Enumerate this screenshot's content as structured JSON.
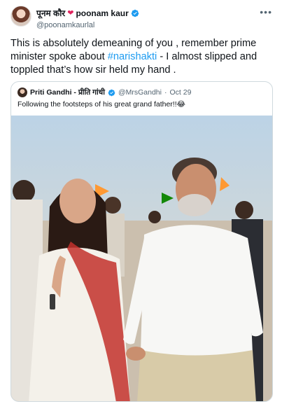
{
  "author": {
    "name_hindi": "पूनम कौर",
    "name": "poonam kaur",
    "handle": "@poonamkaurlal",
    "more_icon": "more-horizontal-icon"
  },
  "tweet": {
    "text_before": "This is absolutely demeaning of you , remember prime minister spoke about ",
    "hashtag": "#narishakti",
    "text_after": " - I almost slipped and toppled that’s how sir held my hand ."
  },
  "quoted": {
    "name": "Priti Gandhi - प्रीति गांधी",
    "handle": "@MrsGandhi",
    "separator": "·",
    "date": "Oct 29",
    "text": "Following the footsteps of his great grand father!!😂"
  },
  "colors": {
    "accent": "#1d9bf0",
    "heart": "#e0245e",
    "muted": "#536471",
    "border": "#cfd9de"
  }
}
